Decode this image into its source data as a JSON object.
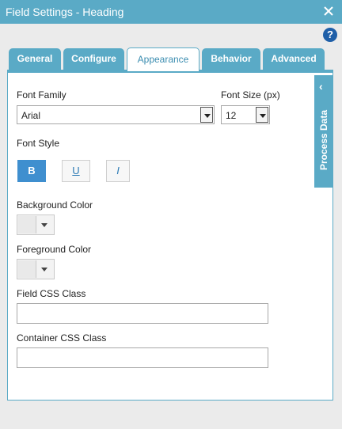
{
  "window": {
    "title": "Field Settings - Heading"
  },
  "tabs": [
    {
      "label": "General"
    },
    {
      "label": "Configure"
    },
    {
      "label": "Appearance"
    },
    {
      "label": "Behavior"
    },
    {
      "label": "Advanced"
    }
  ],
  "active_tab": "Appearance",
  "help": {
    "glyph": "?"
  },
  "form": {
    "font_family": {
      "label": "Font Family",
      "value": "Arial"
    },
    "font_size": {
      "label": "Font Size (px)",
      "value": "12"
    },
    "font_style": {
      "label": "Font Style",
      "bold": "B",
      "underline": "U",
      "italic": "I",
      "bold_active": true
    },
    "background_color": {
      "label": "Background Color"
    },
    "foreground_color": {
      "label": "Foreground Color"
    },
    "field_css_class": {
      "label": "Field CSS Class",
      "value": ""
    },
    "container_css_class": {
      "label": "Container CSS Class",
      "value": ""
    }
  },
  "side_panel": {
    "label": "Process Data",
    "chevron": "‹"
  },
  "colors": {
    "accent": "#5aaac6",
    "button_active": "#3f8fcf",
    "help": "#1f5fa8"
  }
}
